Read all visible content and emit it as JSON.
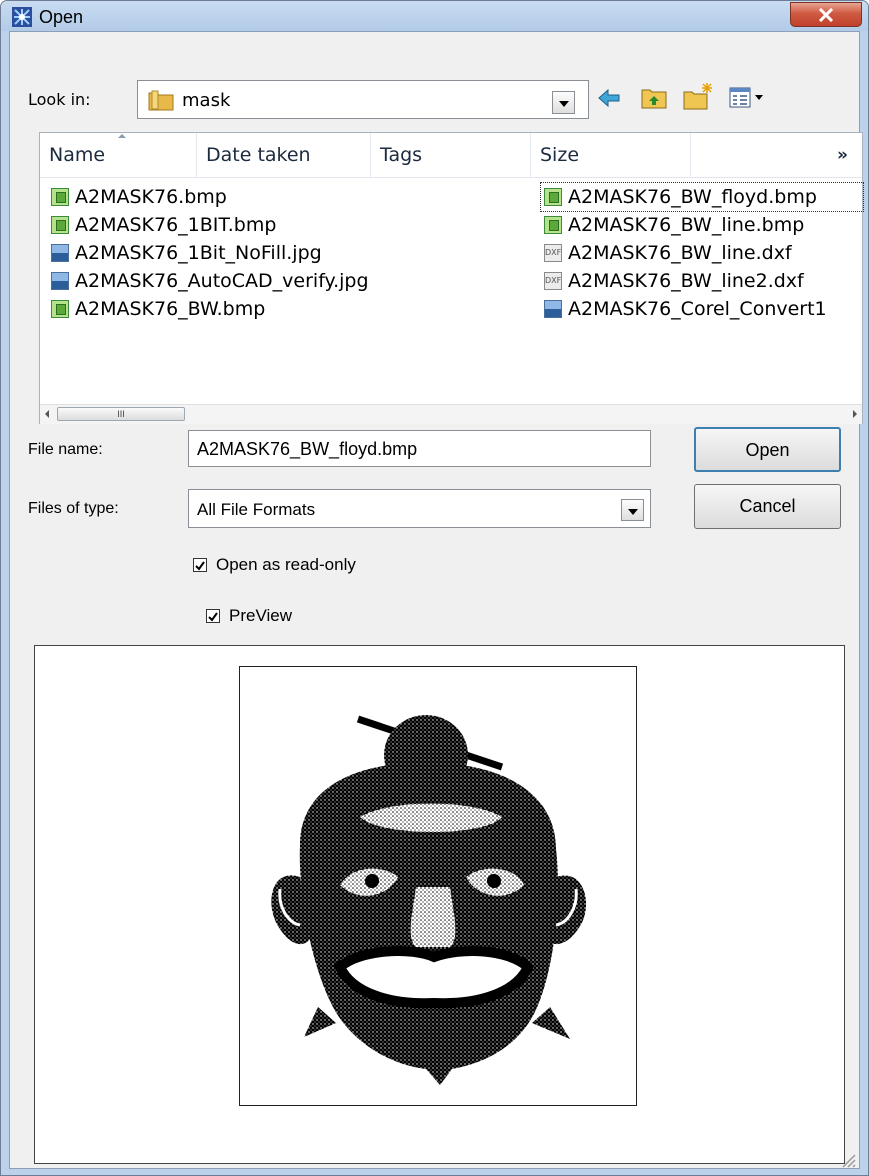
{
  "window": {
    "title": "Open",
    "close_label": "✕"
  },
  "look_in": {
    "label": "Look in:",
    "value": "mask"
  },
  "toolbar": {
    "back_icon": "back-arrow-icon",
    "up_icon": "up-folder-icon",
    "new_folder_icon": "new-folder-icon",
    "views_icon": "views-menu-icon"
  },
  "columns": [
    {
      "label": "Name"
    },
    {
      "label": "Date taken"
    },
    {
      "label": "Tags"
    },
    {
      "label": "Size"
    },
    {
      "label": "»"
    }
  ],
  "files": [
    {
      "name": "A2MASK76.bmp",
      "type": "bmp"
    },
    {
      "name": "A2MASK76_1BIT.bmp",
      "type": "bmp"
    },
    {
      "name": "A2MASK76_1Bit_NoFill.jpg",
      "type": "jpg"
    },
    {
      "name": "A2MASK76_AutoCAD_verify.jpg",
      "type": "jpg"
    },
    {
      "name": "A2MASK76_BW.bmp",
      "type": "bmp"
    },
    {
      "name": "A2MASK76_BW_floyd.bmp",
      "type": "bmp",
      "selected": true
    },
    {
      "name": "A2MASK76_BW_line.bmp",
      "type": "bmp"
    },
    {
      "name": "A2MASK76_BW_line.dxf",
      "type": "dxf"
    },
    {
      "name": "A2MASK76_BW_line2.dxf",
      "type": "dxf"
    },
    {
      "name": "A2MASK76_Corel_Convert1",
      "type": "jpg"
    }
  ],
  "dxf_badge": "DXF",
  "scroll_thumb": "III",
  "file_name": {
    "label": "File name:",
    "value": "A2MASK76_BW_floyd.bmp"
  },
  "file_type": {
    "label": "Files of type:",
    "value": "All File Formats"
  },
  "buttons": {
    "open": "Open",
    "cancel": "Cancel"
  },
  "options": {
    "read_only": {
      "label": "Open as read-only",
      "checked": true
    },
    "preview": {
      "label": "PreView",
      "checked": true
    }
  }
}
